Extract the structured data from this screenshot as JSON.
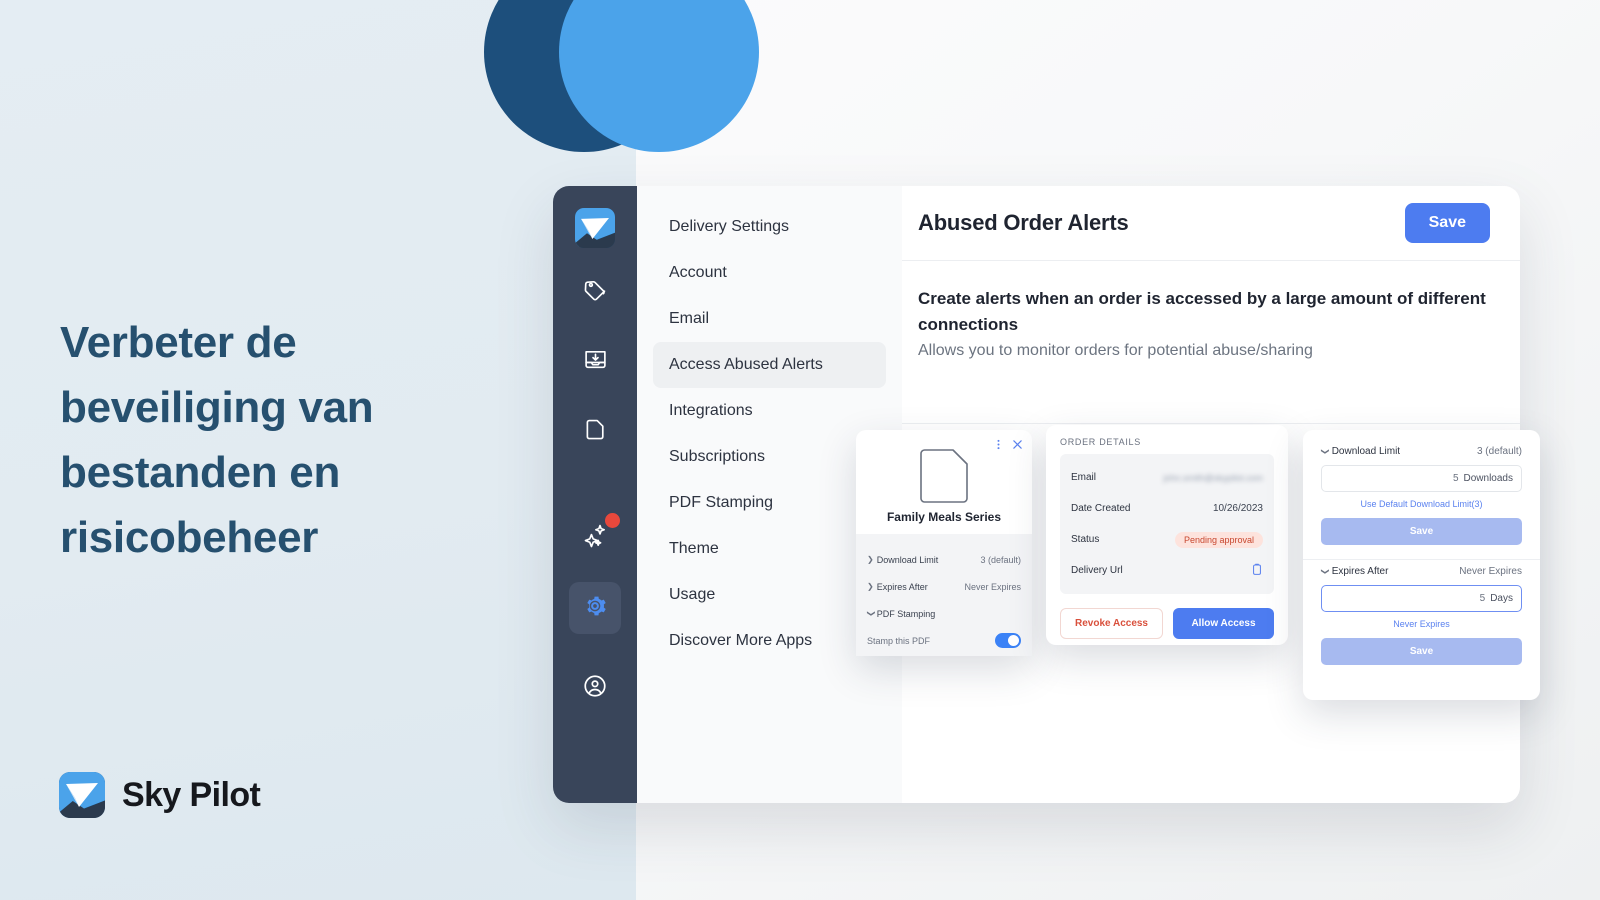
{
  "brand": {
    "name": "Sky Pilot",
    "logo_icon": "paper-plane-logo"
  },
  "headline": "Verbeter de beveiliging van bestanden en risicobeheer",
  "icon_rail": {
    "items": [
      {
        "icon": "app-logo-icon",
        "label": "Sky Pilot",
        "active": false
      },
      {
        "icon": "tag-icon",
        "label": "Products",
        "active": false
      },
      {
        "icon": "inbox-download-icon",
        "label": "Orders",
        "active": false
      },
      {
        "icon": "document-icon",
        "label": "Files",
        "active": false
      },
      {
        "icon": "sparkles-icon",
        "label": "What's New",
        "active": false,
        "badge": true
      },
      {
        "icon": "gear-icon",
        "label": "Settings",
        "active": true
      },
      {
        "icon": "account-icon",
        "label": "Account",
        "active": false
      }
    ]
  },
  "settings_nav": {
    "items": [
      {
        "label": "Delivery Settings",
        "active": false
      },
      {
        "label": "Account",
        "active": false
      },
      {
        "label": "Email",
        "active": false
      },
      {
        "label": "Access Abused Alerts",
        "active": true
      },
      {
        "label": "Integrations",
        "active": false
      },
      {
        "label": "Subscriptions",
        "active": false
      },
      {
        "label": "PDF Stamping",
        "active": false
      },
      {
        "label": "Theme",
        "active": false
      },
      {
        "label": "Usage",
        "active": false
      },
      {
        "label": "Discover More Apps",
        "active": false
      }
    ]
  },
  "main": {
    "page_title": "Abused Order Alerts",
    "save_label": "Save",
    "alerts_heading": "Create alerts when an order is accessed by a large amount of different connections",
    "alerts_subtext": "Allows you to monitor orders for potential abuse/sharing"
  },
  "product_card": {
    "title": "Family Meals Series",
    "doc_icon": "document-icon",
    "menu_icon": "kebab-menu-icon",
    "close_icon": "close-icon",
    "rows": [
      {
        "label": "Download Limit",
        "value": "3 (default)",
        "caret": "collapsed"
      },
      {
        "label": "Expires After",
        "value": "Never Expires",
        "caret": "collapsed"
      },
      {
        "label": "PDF Stamping",
        "value": "",
        "caret": "expanded"
      }
    ],
    "stamp_label": "Stamp this PDF",
    "stamp_enabled": true
  },
  "order_card": {
    "title": "ORDER DETAILS",
    "rows": [
      {
        "label": "Email",
        "value": "john.smith@skypilot.com",
        "redacted": true
      },
      {
        "label": "Date Created",
        "value": "10/26/2023",
        "redacted": false
      },
      {
        "label": "Status",
        "value": "Pending approval",
        "badge": true
      },
      {
        "label": "Delivery Url",
        "value": "",
        "icon": "copy-icon"
      }
    ],
    "revoke_label": "Revoke Access",
    "allow_label": "Allow Access"
  },
  "limits_card": {
    "download_limit": {
      "label": "Download Limit",
      "value": "3 (default)",
      "input_value": "5",
      "input_unit": "Downloads",
      "link_label": "Use Default Download Limit(3)",
      "save_label": "Save"
    },
    "expires_after": {
      "label": "Expires After",
      "value": "Never Expires",
      "input_value": "5",
      "input_unit": "Days",
      "link_label": "Never Expires",
      "save_label": "Save"
    }
  },
  "colors": {
    "headline": "#26506f",
    "accent_blue": "#4d7cf0",
    "rail_bg": "#39455a",
    "deco_dark": "#1d4f7c",
    "deco_light": "#4ba3ea",
    "badge_red": "#e8483c",
    "danger": "#d9503c",
    "page_bg": "#e3ecf2"
  }
}
